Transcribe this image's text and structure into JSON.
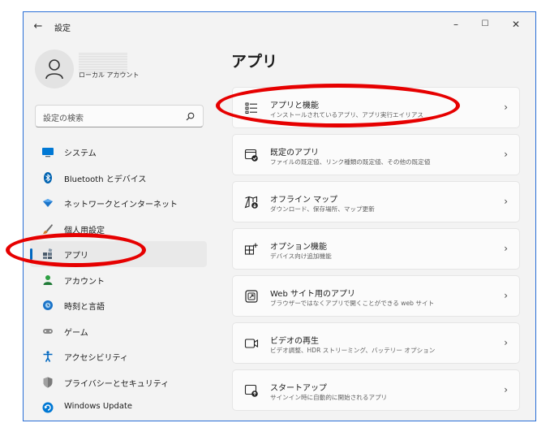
{
  "window": {
    "title": "設定",
    "back_icon": "arrow-left-icon",
    "controls": {
      "minimize": "–",
      "maximize": "☐",
      "close": "✕"
    }
  },
  "account": {
    "type": "ローカル アカウント",
    "avatar_icon": "person-icon"
  },
  "search": {
    "placeholder": "設定の検索",
    "icon": "search-icon"
  },
  "nav": {
    "items": [
      {
        "label": "システム",
        "icon": "monitor-icon",
        "color": "#0078d4"
      },
      {
        "label": "Bluetooth とデバイス",
        "icon": "bluetooth-icon",
        "color": "#0063b1"
      },
      {
        "label": "ネットワークとインターネット",
        "icon": "wifi-diamond-icon",
        "color": "#1a73c8"
      },
      {
        "label": "個人用設定",
        "icon": "brush-icon",
        "color": "#d07a2c"
      },
      {
        "label": "アプリ",
        "icon": "apps-icon",
        "color": "#4a5b6b",
        "selected": true
      },
      {
        "label": "アカウント",
        "icon": "person-icon",
        "color": "#2ea043"
      },
      {
        "label": "時刻と言語",
        "icon": "globe-clock-icon",
        "color": "#1a73c8"
      },
      {
        "label": "ゲーム",
        "icon": "gamepad-icon",
        "color": "#7a7a7a"
      },
      {
        "label": "アクセシビリティ",
        "icon": "accessibility-icon",
        "color": "#0067c0"
      },
      {
        "label": "プライバシーとセキュリティ",
        "icon": "shield-icon",
        "color": "#6d6d6d"
      },
      {
        "label": "Windows Update",
        "icon": "update-icon",
        "color": "#0078d4"
      }
    ]
  },
  "main": {
    "title": "アプリ",
    "cards": [
      {
        "title": "アプリと機能",
        "desc": "インストールされているアプリ、アプリ実行エイリアス",
        "icon": "apps-list-icon"
      },
      {
        "title": "既定のアプリ",
        "desc": "ファイルの既定値、リンク種類の既定値、その他の既定値",
        "icon": "default-apps-icon"
      },
      {
        "title": "オフライン マップ",
        "desc": "ダウンロード、保存場所、マップ更新",
        "icon": "offline-map-icon"
      },
      {
        "title": "オプション機能",
        "desc": "デバイス向け追加機能",
        "icon": "optional-features-icon"
      },
      {
        "title": "Web サイト用のアプリ",
        "desc": "ブラウザーではなくアプリで開くことができる web サイト",
        "icon": "web-apps-icon"
      },
      {
        "title": "ビデオの再生",
        "desc": "ビデオ調整、HDR ストリーミング、バッテリー オプション",
        "icon": "video-icon"
      },
      {
        "title": "スタートアップ",
        "desc": "サインイン時に自動的に開始されるアプリ",
        "icon": "startup-icon"
      }
    ],
    "chevron": "›"
  },
  "annotation_color": "#e60000"
}
